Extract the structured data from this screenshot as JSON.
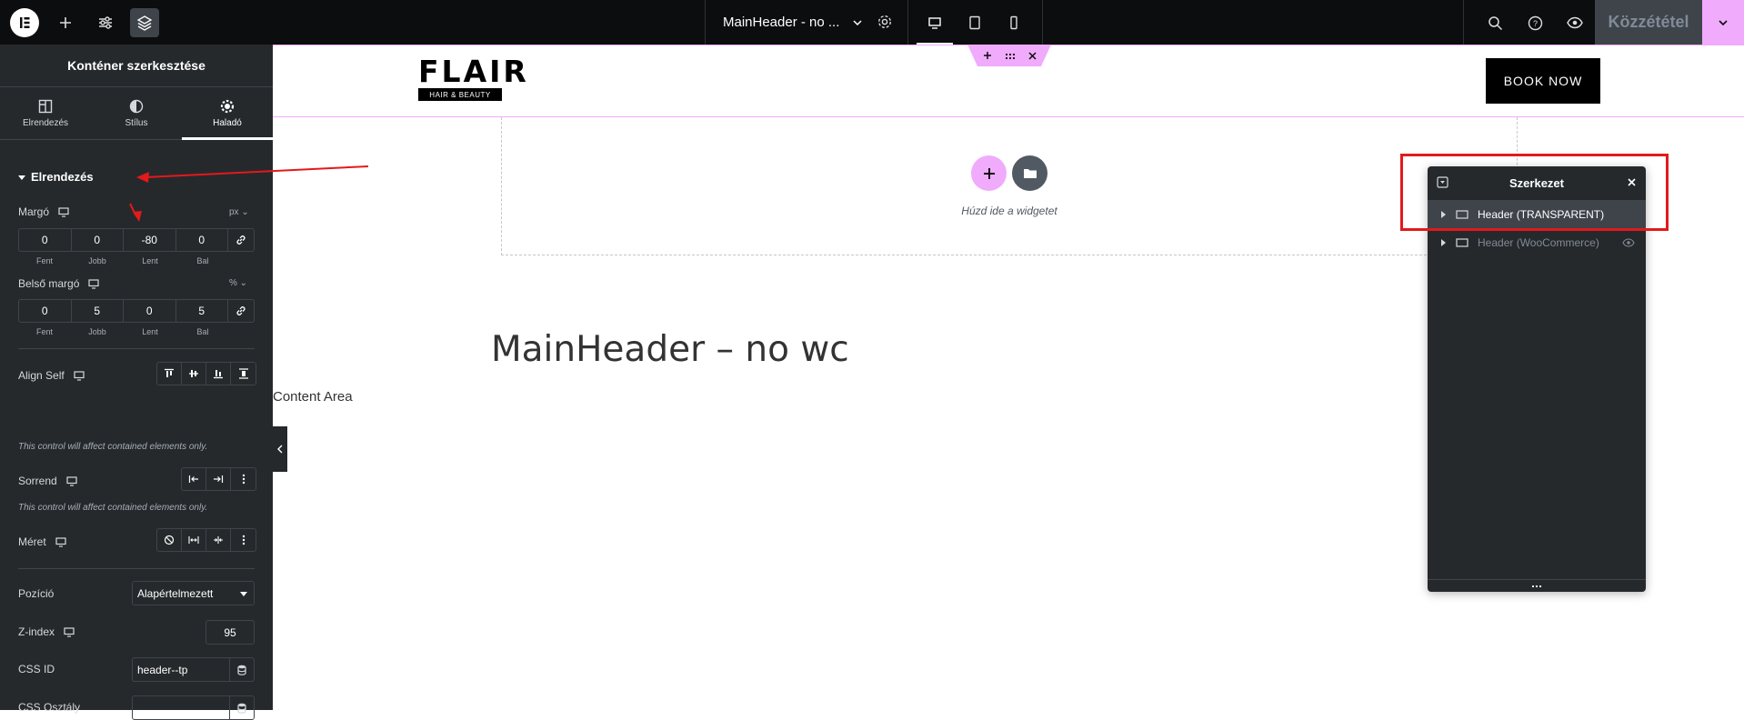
{
  "topbar": {
    "doc_title": "MainHeader - no ...",
    "publish_label": "Közzététel"
  },
  "panel": {
    "title": "Konténer szerkesztése",
    "tabs": [
      {
        "label": "Elrendezés"
      },
      {
        "label": "Stílus"
      },
      {
        "label": "Haladó"
      }
    ],
    "section": "Elrendezés",
    "margin": {
      "label": "Margó",
      "unit": "px",
      "values": [
        "0",
        "0",
        "-80",
        "0"
      ],
      "sides": [
        "Fent",
        "Jobb",
        "Lent",
        "Bal"
      ]
    },
    "padding": {
      "label": "Belső margó",
      "unit": "%",
      "values": [
        "0",
        "5",
        "0",
        "5"
      ],
      "sides": [
        "Fent",
        "Jobb",
        "Lent",
        "Bal"
      ]
    },
    "align_self": {
      "label": "Align Self",
      "hint": "This control will affect contained elements only."
    },
    "order": {
      "label": "Sorrend",
      "hint": "This control will affect contained elements only."
    },
    "size": {
      "label": "Méret"
    },
    "position": {
      "label": "Pozíció",
      "value": "Alapértelmezett"
    },
    "zindex": {
      "label": "Z-index",
      "value": "95"
    },
    "css_id": {
      "label": "CSS ID",
      "value": "header--tp"
    },
    "css_class": {
      "label": "CSS Osztály",
      "value": ""
    }
  },
  "canvas": {
    "logo_word": "FLAIR",
    "logo_sub": "HAIR & BEAUTY",
    "book_label": "BOOK NOW",
    "drop_text": "Húzd ide a widgetet",
    "page_title": "MainHeader – no wc",
    "content_area": "Content Area"
  },
  "navigator": {
    "title": "Szerkezet",
    "items": [
      {
        "label": "Header (TRANSPARENT)"
      },
      {
        "label": "Header (WooCommerce)"
      }
    ]
  },
  "colors": {
    "accent": "#f0abfc",
    "panel_bg": "#26292c",
    "annotation": "#e3191b"
  }
}
